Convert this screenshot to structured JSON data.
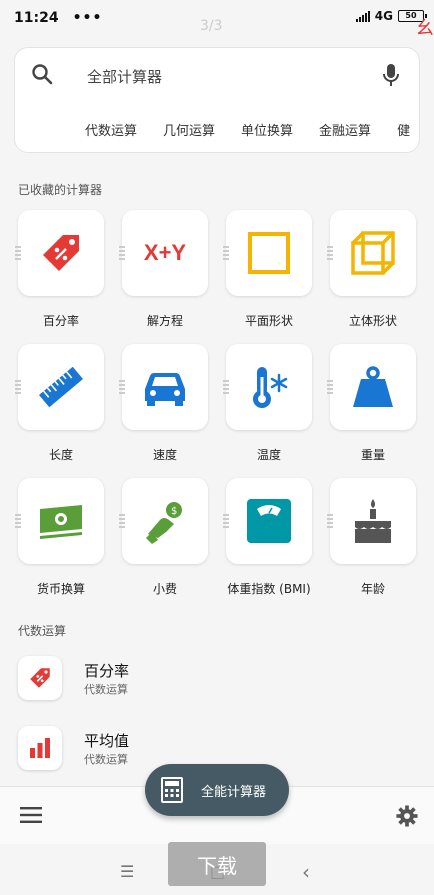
{
  "status": {
    "time": "11:24",
    "dots": "•••",
    "network": "4G",
    "battery": "50"
  },
  "overlay": {
    "page_indicator": "3/3",
    "edge_char": "幺"
  },
  "search": {
    "placeholder": "全部计算器",
    "chips": [
      "代数运算",
      "几何运算",
      "单位换算",
      "金融运算",
      "健"
    ]
  },
  "favorites": {
    "label": "已收藏的计算器",
    "items": [
      {
        "label": "百分率",
        "icon": "percent-tag-icon"
      },
      {
        "label": "解方程",
        "icon": "x-plus-y-icon",
        "glyph": "X+Y"
      },
      {
        "label": "平面形状",
        "icon": "square-icon"
      },
      {
        "label": "立体形状",
        "icon": "cube-icon"
      },
      {
        "label": "长度",
        "icon": "ruler-icon"
      },
      {
        "label": "速度",
        "icon": "car-icon"
      },
      {
        "label": "温度",
        "icon": "thermometer-icon"
      },
      {
        "label": "重量",
        "icon": "weight-icon"
      },
      {
        "label": "货币换算",
        "icon": "banknotes-icon"
      },
      {
        "label": "小费",
        "icon": "tip-hand-icon"
      },
      {
        "label": "体重指数 (BMI)",
        "icon": "scale-icon"
      },
      {
        "label": "年龄",
        "icon": "birthday-cake-icon"
      }
    ]
  },
  "algebra": {
    "label": "代数运算",
    "items": [
      {
        "title": "百分率",
        "subtitle": "代数运算",
        "icon": "percent-tag-icon"
      },
      {
        "title": "平均值",
        "subtitle": "代数运算",
        "icon": "bar-chart-icon"
      }
    ]
  },
  "fab": {
    "label": "全能计算器",
    "icon": "calculator-icon"
  },
  "download": {
    "label": "下载"
  },
  "colors": {
    "red": "#e53935",
    "orange": "#f4b400",
    "blue": "#1976d2",
    "green": "#5a9e3a",
    "teal": "#0097a7",
    "gray": "#555555",
    "fab": "#455a64"
  }
}
